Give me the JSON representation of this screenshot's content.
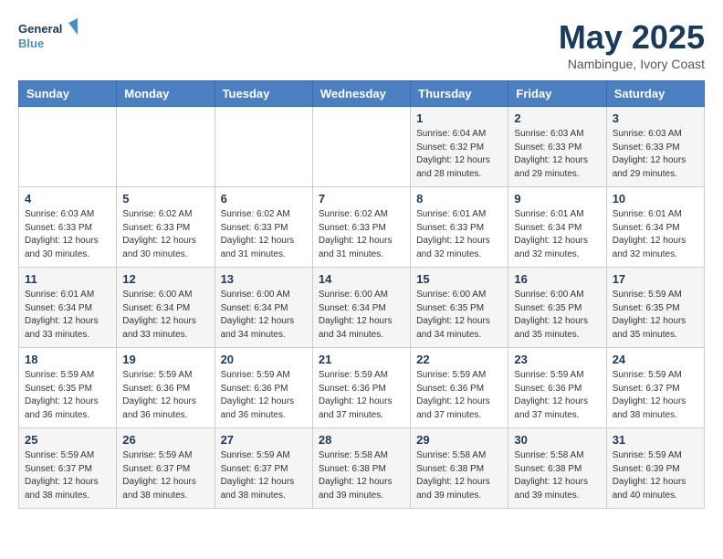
{
  "header": {
    "logo_line1": "General",
    "logo_line2": "Blue",
    "title": "May 2025",
    "subtitle": "Nambingue, Ivory Coast"
  },
  "days_of_week": [
    "Sunday",
    "Monday",
    "Tuesday",
    "Wednesday",
    "Thursday",
    "Friday",
    "Saturday"
  ],
  "weeks": [
    [
      {
        "day": "",
        "info": ""
      },
      {
        "day": "",
        "info": ""
      },
      {
        "day": "",
        "info": ""
      },
      {
        "day": "",
        "info": ""
      },
      {
        "day": "1",
        "info": "Sunrise: 6:04 AM\nSunset: 6:32 PM\nDaylight: 12 hours\nand 28 minutes."
      },
      {
        "day": "2",
        "info": "Sunrise: 6:03 AM\nSunset: 6:33 PM\nDaylight: 12 hours\nand 29 minutes."
      },
      {
        "day": "3",
        "info": "Sunrise: 6:03 AM\nSunset: 6:33 PM\nDaylight: 12 hours\nand 29 minutes."
      }
    ],
    [
      {
        "day": "4",
        "info": "Sunrise: 6:03 AM\nSunset: 6:33 PM\nDaylight: 12 hours\nand 30 minutes."
      },
      {
        "day": "5",
        "info": "Sunrise: 6:02 AM\nSunset: 6:33 PM\nDaylight: 12 hours\nand 30 minutes."
      },
      {
        "day": "6",
        "info": "Sunrise: 6:02 AM\nSunset: 6:33 PM\nDaylight: 12 hours\nand 31 minutes."
      },
      {
        "day": "7",
        "info": "Sunrise: 6:02 AM\nSunset: 6:33 PM\nDaylight: 12 hours\nand 31 minutes."
      },
      {
        "day": "8",
        "info": "Sunrise: 6:01 AM\nSunset: 6:33 PM\nDaylight: 12 hours\nand 32 minutes."
      },
      {
        "day": "9",
        "info": "Sunrise: 6:01 AM\nSunset: 6:34 PM\nDaylight: 12 hours\nand 32 minutes."
      },
      {
        "day": "10",
        "info": "Sunrise: 6:01 AM\nSunset: 6:34 PM\nDaylight: 12 hours\nand 32 minutes."
      }
    ],
    [
      {
        "day": "11",
        "info": "Sunrise: 6:01 AM\nSunset: 6:34 PM\nDaylight: 12 hours\nand 33 minutes."
      },
      {
        "day": "12",
        "info": "Sunrise: 6:00 AM\nSunset: 6:34 PM\nDaylight: 12 hours\nand 33 minutes."
      },
      {
        "day": "13",
        "info": "Sunrise: 6:00 AM\nSunset: 6:34 PM\nDaylight: 12 hours\nand 34 minutes."
      },
      {
        "day": "14",
        "info": "Sunrise: 6:00 AM\nSunset: 6:34 PM\nDaylight: 12 hours\nand 34 minutes."
      },
      {
        "day": "15",
        "info": "Sunrise: 6:00 AM\nSunset: 6:35 PM\nDaylight: 12 hours\nand 34 minutes."
      },
      {
        "day": "16",
        "info": "Sunrise: 6:00 AM\nSunset: 6:35 PM\nDaylight: 12 hours\nand 35 minutes."
      },
      {
        "day": "17",
        "info": "Sunrise: 5:59 AM\nSunset: 6:35 PM\nDaylight: 12 hours\nand 35 minutes."
      }
    ],
    [
      {
        "day": "18",
        "info": "Sunrise: 5:59 AM\nSunset: 6:35 PM\nDaylight: 12 hours\nand 36 minutes."
      },
      {
        "day": "19",
        "info": "Sunrise: 5:59 AM\nSunset: 6:36 PM\nDaylight: 12 hours\nand 36 minutes."
      },
      {
        "day": "20",
        "info": "Sunrise: 5:59 AM\nSunset: 6:36 PM\nDaylight: 12 hours\nand 36 minutes."
      },
      {
        "day": "21",
        "info": "Sunrise: 5:59 AM\nSunset: 6:36 PM\nDaylight: 12 hours\nand 37 minutes."
      },
      {
        "day": "22",
        "info": "Sunrise: 5:59 AM\nSunset: 6:36 PM\nDaylight: 12 hours\nand 37 minutes."
      },
      {
        "day": "23",
        "info": "Sunrise: 5:59 AM\nSunset: 6:36 PM\nDaylight: 12 hours\nand 37 minutes."
      },
      {
        "day": "24",
        "info": "Sunrise: 5:59 AM\nSunset: 6:37 PM\nDaylight: 12 hours\nand 38 minutes."
      }
    ],
    [
      {
        "day": "25",
        "info": "Sunrise: 5:59 AM\nSunset: 6:37 PM\nDaylight: 12 hours\nand 38 minutes."
      },
      {
        "day": "26",
        "info": "Sunrise: 5:59 AM\nSunset: 6:37 PM\nDaylight: 12 hours\nand 38 minutes."
      },
      {
        "day": "27",
        "info": "Sunrise: 5:59 AM\nSunset: 6:37 PM\nDaylight: 12 hours\nand 38 minutes."
      },
      {
        "day": "28",
        "info": "Sunrise: 5:58 AM\nSunset: 6:38 PM\nDaylight: 12 hours\nand 39 minutes."
      },
      {
        "day": "29",
        "info": "Sunrise: 5:58 AM\nSunset: 6:38 PM\nDaylight: 12 hours\nand 39 minutes."
      },
      {
        "day": "30",
        "info": "Sunrise: 5:58 AM\nSunset: 6:38 PM\nDaylight: 12 hours\nand 39 minutes."
      },
      {
        "day": "31",
        "info": "Sunrise: 5:59 AM\nSunset: 6:39 PM\nDaylight: 12 hours\nand 40 minutes."
      }
    ]
  ]
}
